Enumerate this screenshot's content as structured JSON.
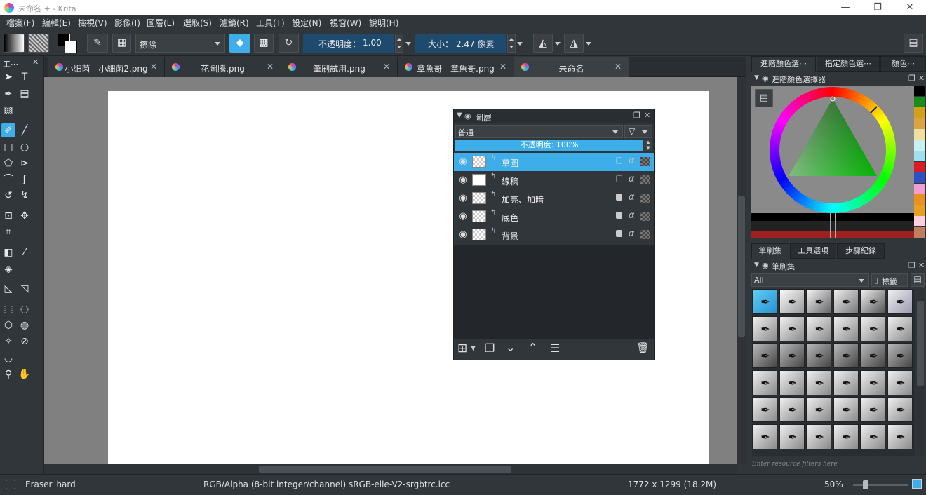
{
  "window": {
    "title": "未命名 + - Krita",
    "min_label": "—",
    "max_label": "❐",
    "close_label": "✕"
  },
  "menu": [
    "檔案(F)",
    "編輯(E)",
    "檢視(V)",
    "影像(I)",
    "圖層(L)",
    "選取(S)",
    "濾鏡(R)",
    "工具(T)",
    "設定(N)",
    "視窗(W)",
    "說明(H)"
  ],
  "toolbar": {
    "blend_mode": "擦除",
    "opacity_label": "不透明度：",
    "opacity_value": "1.00",
    "size_label": "大小：",
    "size_value": "2.47 像素"
  },
  "toolbox": {
    "title": "工⋯"
  },
  "tabs": [
    {
      "label": "小細菌 - 小細菌2.png"
    },
    {
      "label": "花圖騰.png"
    },
    {
      "label": "筆刷試用.png"
    },
    {
      "label": "章魚哥 - 章魚哥.png"
    },
    {
      "label": "未命名"
    }
  ],
  "layers_panel": {
    "title": "圖層",
    "blend_mode": "普通",
    "opacity_text": "不透明度:  100%",
    "layers": [
      {
        "name": "草圖",
        "selected": true,
        "thumb": "checker",
        "locked": false
      },
      {
        "name": "線稿",
        "selected": false,
        "thumb": "solid",
        "locked": false
      },
      {
        "name": "加亮、加暗",
        "selected": false,
        "thumb": "checker",
        "locked": true
      },
      {
        "name": "底色",
        "selected": false,
        "thumb": "checker",
        "locked": true
      },
      {
        "name": "背景",
        "selected": false,
        "thumb": "checker",
        "locked": true
      }
    ]
  },
  "dock_top_tabs": [
    "進階顏色選⋯",
    "指定顏色選⋯",
    "顏色⋯"
  ],
  "color_selector": {
    "title": "進階顏色選擇器"
  },
  "swatches": [
    "#000000",
    "#1a8c1a",
    "#d4a017",
    "#d9a441",
    "#f0e0a0",
    "#c8f0f0",
    "#a0e0f0",
    "#d81b24",
    "#3050c0",
    "#f0a0d0",
    "#e89020",
    "#e8a020",
    "#ffd0e0",
    "#c08060"
  ],
  "dock_bottom_tabs": [
    "筆刷集",
    "工具選項",
    "步驟紀錄"
  ],
  "brush_presets": {
    "title": "筆刷集",
    "filter": "All",
    "tag_label": "標籤",
    "search_placeholder": "Enter resource filters here"
  },
  "status": {
    "brush_name": "Eraser_hard",
    "color_info": "RGB/Alpha (8-bit integer/channel)  sRGB-elle-V2-srgbtrc.icc",
    "dimensions": "1772 x 1299 (18.2M)",
    "zoom": "50%"
  },
  "colors": {
    "accent": "#3daee9",
    "panel": "#31363b",
    "canvas_bg": "#808080"
  }
}
